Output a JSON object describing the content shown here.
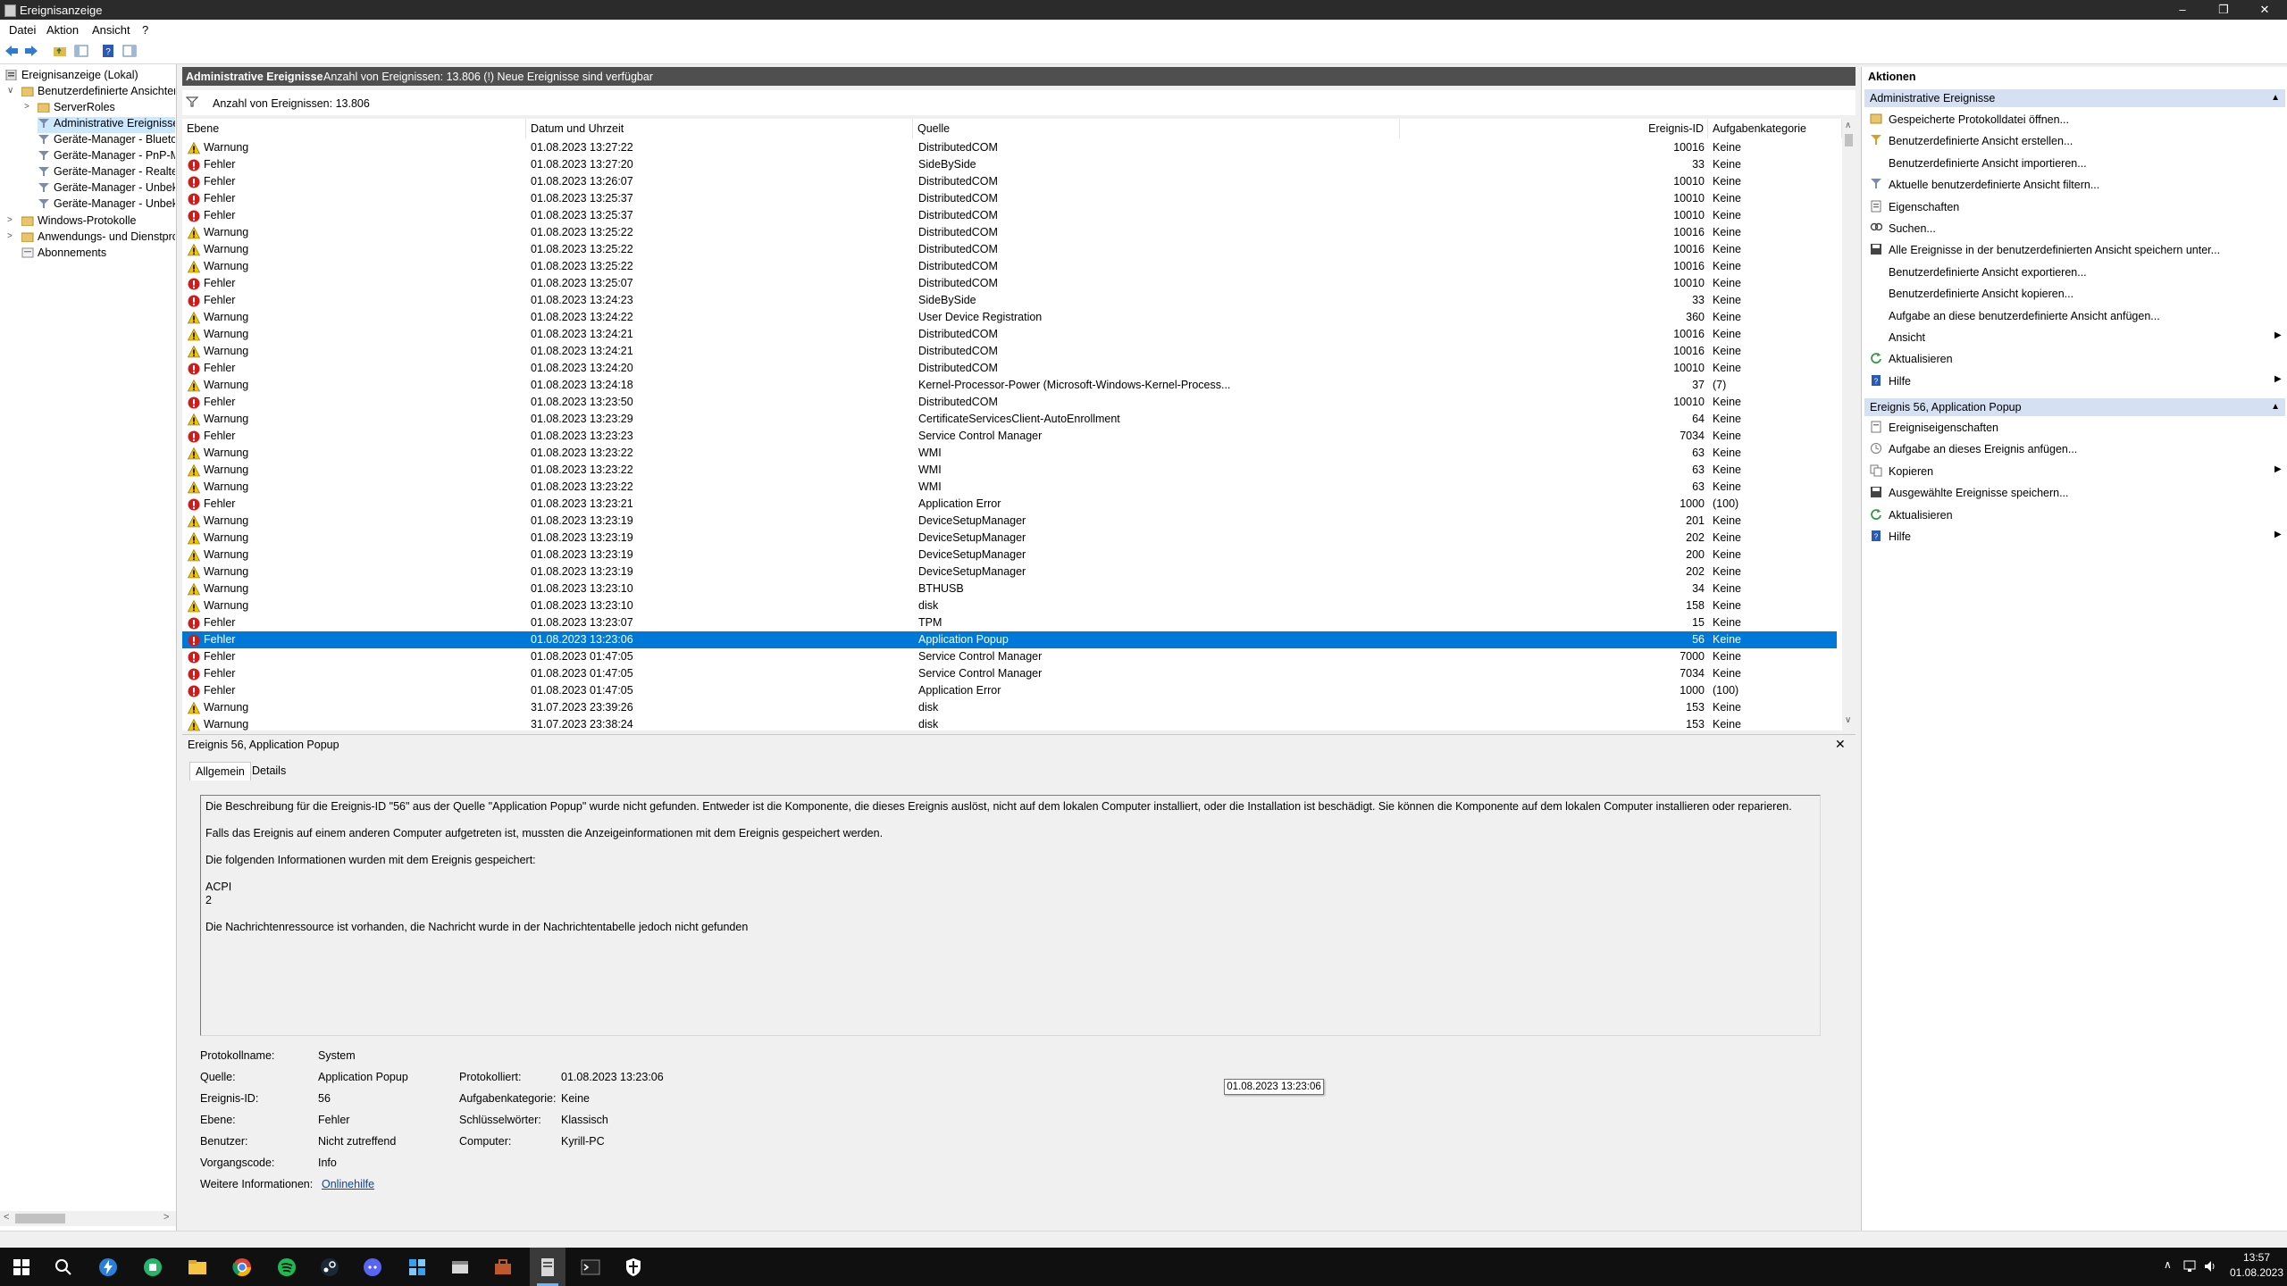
{
  "window": {
    "title": "Ereignisanzeige"
  },
  "menu": [
    "Datei",
    "Aktion",
    "Ansicht",
    "?"
  ],
  "tree": {
    "root": "Ereignisanzeige (Lokal)",
    "custom_views": "Benutzerdefinierte Ansichten",
    "children": [
      "ServerRoles",
      "Administrative Ereignisse",
      "Geräte-Manager - Blueto",
      "Geräte-Manager - PnP-M",
      "Geräte-Manager - Realtel",
      "Geräte-Manager - Unbek",
      "Geräte-Manager - Unbek"
    ],
    "windows_logs": "Windows-Protokolle",
    "app_logs": "Anwendungs- und Dienstpro",
    "subscriptions": "Abonnements"
  },
  "center": {
    "title": "Administrative Ereignisse",
    "subtitle": "Anzahl von Ereignissen: 13.806 (!) Neue Ereignisse sind verfügbar",
    "filter_text": "Anzahl von Ereignissen: 13.806",
    "columns": {
      "level": "Ebene",
      "date": "Datum und Uhrzeit",
      "source": "Quelle",
      "id": "Ereignis-ID",
      "task": "Aufgabenkategorie"
    }
  },
  "events": [
    {
      "level": "Warnung",
      "date": "01.08.2023 13:27:22",
      "source": "DistributedCOM",
      "id": "10016",
      "task": "Keine"
    },
    {
      "level": "Fehler",
      "date": "01.08.2023 13:27:20",
      "source": "SideBySide",
      "id": "33",
      "task": "Keine"
    },
    {
      "level": "Fehler",
      "date": "01.08.2023 13:26:07",
      "source": "DistributedCOM",
      "id": "10010",
      "task": "Keine"
    },
    {
      "level": "Fehler",
      "date": "01.08.2023 13:25:37",
      "source": "DistributedCOM",
      "id": "10010",
      "task": "Keine"
    },
    {
      "level": "Fehler",
      "date": "01.08.2023 13:25:37",
      "source": "DistributedCOM",
      "id": "10010",
      "task": "Keine"
    },
    {
      "level": "Warnung",
      "date": "01.08.2023 13:25:22",
      "source": "DistributedCOM",
      "id": "10016",
      "task": "Keine"
    },
    {
      "level": "Warnung",
      "date": "01.08.2023 13:25:22",
      "source": "DistributedCOM",
      "id": "10016",
      "task": "Keine"
    },
    {
      "level": "Warnung",
      "date": "01.08.2023 13:25:22",
      "source": "DistributedCOM",
      "id": "10016",
      "task": "Keine"
    },
    {
      "level": "Fehler",
      "date": "01.08.2023 13:25:07",
      "source": "DistributedCOM",
      "id": "10010",
      "task": "Keine"
    },
    {
      "level": "Fehler",
      "date": "01.08.2023 13:24:23",
      "source": "SideBySide",
      "id": "33",
      "task": "Keine"
    },
    {
      "level": "Warnung",
      "date": "01.08.2023 13:24:22",
      "source": "User Device Registration",
      "id": "360",
      "task": "Keine"
    },
    {
      "level": "Warnung",
      "date": "01.08.2023 13:24:21",
      "source": "DistributedCOM",
      "id": "10016",
      "task": "Keine"
    },
    {
      "level": "Warnung",
      "date": "01.08.2023 13:24:21",
      "source": "DistributedCOM",
      "id": "10016",
      "task": "Keine"
    },
    {
      "level": "Fehler",
      "date": "01.08.2023 13:24:20",
      "source": "DistributedCOM",
      "id": "10010",
      "task": "Keine"
    },
    {
      "level": "Warnung",
      "date": "01.08.2023 13:24:18",
      "source": "Kernel-Processor-Power (Microsoft-Windows-Kernel-Process...",
      "id": "37",
      "task": "(7)"
    },
    {
      "level": "Fehler",
      "date": "01.08.2023 13:23:50",
      "source": "DistributedCOM",
      "id": "10010",
      "task": "Keine"
    },
    {
      "level": "Warnung",
      "date": "01.08.2023 13:23:29",
      "source": "CertificateServicesClient-AutoEnrollment",
      "id": "64",
      "task": "Keine"
    },
    {
      "level": "Fehler",
      "date": "01.08.2023 13:23:23",
      "source": "Service Control Manager",
      "id": "7034",
      "task": "Keine"
    },
    {
      "level": "Warnung",
      "date": "01.08.2023 13:23:22",
      "source": "WMI",
      "id": "63",
      "task": "Keine"
    },
    {
      "level": "Warnung",
      "date": "01.08.2023 13:23:22",
      "source": "WMI",
      "id": "63",
      "task": "Keine"
    },
    {
      "level": "Warnung",
      "date": "01.08.2023 13:23:22",
      "source": "WMI",
      "id": "63",
      "task": "Keine"
    },
    {
      "level": "Fehler",
      "date": "01.08.2023 13:23:21",
      "source": "Application Error",
      "id": "1000",
      "task": "(100)"
    },
    {
      "level": "Warnung",
      "date": "01.08.2023 13:23:19",
      "source": "DeviceSetupManager",
      "id": "201",
      "task": "Keine"
    },
    {
      "level": "Warnung",
      "date": "01.08.2023 13:23:19",
      "source": "DeviceSetupManager",
      "id": "202",
      "task": "Keine"
    },
    {
      "level": "Warnung",
      "date": "01.08.2023 13:23:19",
      "source": "DeviceSetupManager",
      "id": "200",
      "task": "Keine"
    },
    {
      "level": "Warnung",
      "date": "01.08.2023 13:23:19",
      "source": "DeviceSetupManager",
      "id": "202",
      "task": "Keine"
    },
    {
      "level": "Warnung",
      "date": "01.08.2023 13:23:10",
      "source": "BTHUSB",
      "id": "34",
      "task": "Keine"
    },
    {
      "level": "Warnung",
      "date": "01.08.2023 13:23:10",
      "source": "disk",
      "id": "158",
      "task": "Keine"
    },
    {
      "level": "Fehler",
      "date": "01.08.2023 13:23:07",
      "source": "TPM",
      "id": "15",
      "task": "Keine"
    },
    {
      "level": "Fehler",
      "date": "01.08.2023 13:23:06",
      "source": "Application Popup",
      "id": "56",
      "task": "Keine",
      "selected": true
    },
    {
      "level": "Fehler",
      "date": "01.08.2023 01:47:05",
      "source": "Service Control Manager",
      "id": "7000",
      "task": "Keine"
    },
    {
      "level": "Fehler",
      "date": "01.08.2023 01:47:05",
      "source": "Service Control Manager",
      "id": "7034",
      "task": "Keine"
    },
    {
      "level": "Fehler",
      "date": "01.08.2023 01:47:05",
      "source": "Application Error",
      "id": "1000",
      "task": "(100)"
    },
    {
      "level": "Warnung",
      "date": "31.07.2023 23:39:26",
      "source": "disk",
      "id": "153",
      "task": "Keine"
    },
    {
      "level": "Warnung",
      "date": "31.07.2023 23:38:24",
      "source": "disk",
      "id": "153",
      "task": "Keine"
    }
  ],
  "detail": {
    "title": "Ereignis 56, Application Popup",
    "tabs": [
      "Allgemein",
      "Details"
    ],
    "message": [
      "Die Beschreibung für die Ereignis-ID \"56\" aus der Quelle \"Application Popup\" wurde nicht gefunden. Entweder ist die Komponente, die dieses Ereignis auslöst, nicht auf dem lokalen Computer installiert, oder die Installation ist beschädigt. Sie können die Komponente auf dem lokalen Computer installieren oder reparieren.",
      "Falls das Ereignis auf einem anderen Computer aufgetreten ist, mussten die Anzeigeinformationen mit dem Ereignis gespeichert werden.",
      "Die folgenden Informationen wurden mit dem Ereignis gespeichert:",
      "ACPI",
      "2",
      "Die Nachrichtenressource ist vorhanden, die Nachricht wurde in der Nachrichtentabelle jedoch nicht gefunden"
    ],
    "fields": {
      "log_name_label": "Protokollname:",
      "log_name": "System",
      "source_label": "Quelle:",
      "source": "Application Popup",
      "logged_label": "Protokolliert:",
      "logged": "01.08.2023 13:23:06",
      "event_id_label": "Ereignis-ID:",
      "event_id": "56",
      "task_label": "Aufgabenkategorie:",
      "task": "Keine",
      "level_label": "Ebene:",
      "level": "Fehler",
      "keywords_label": "Schlüsselwörter:",
      "keywords": "Klassisch",
      "user_label": "Benutzer:",
      "user": "Nicht zutreffend",
      "computer_label": "Computer:",
      "computer": "Kyrill-PC",
      "opcode_label": "Vorgangscode:",
      "opcode": "Info",
      "more_label": "Weitere Informationen:",
      "more_link": "Onlinehilfe"
    },
    "tooltip": "01.08.2023 13:23:06"
  },
  "actions": {
    "header": "Aktionen",
    "section1": {
      "title": "Administrative Ereignisse",
      "items": [
        {
          "label": "Gespeicherte Protokolldatei öffnen...",
          "icon": "open-log-icon"
        },
        {
          "label": "Benutzerdefinierte Ansicht erstellen...",
          "icon": "filter-create-icon"
        },
        {
          "label": "Benutzerdefinierte Ansicht importieren...",
          "icon": ""
        },
        {
          "label": "Aktuelle benutzerdefinierte Ansicht filtern...",
          "icon": "filter-icon"
        },
        {
          "label": "Eigenschaften",
          "icon": "properties-icon"
        },
        {
          "label": "Suchen...",
          "icon": "find-icon"
        },
        {
          "label": "Alle Ereignisse in der benutzerdefinierten Ansicht speichern unter...",
          "icon": "save-icon"
        },
        {
          "label": "Benutzerdefinierte Ansicht exportieren...",
          "icon": ""
        },
        {
          "label": "Benutzerdefinierte Ansicht kopieren...",
          "icon": ""
        },
        {
          "label": "Aufgabe an diese benutzerdefinierte Ansicht anfügen...",
          "icon": ""
        },
        {
          "label": "Ansicht",
          "icon": "",
          "submenu": true
        },
        {
          "label": "Aktualisieren",
          "icon": "refresh-icon"
        },
        {
          "label": "Hilfe",
          "icon": "help-icon",
          "submenu": true
        }
      ]
    },
    "section2": {
      "title": "Ereignis 56, Application Popup",
      "items": [
        {
          "label": "Ereigniseigenschaften",
          "icon": "event-properties-icon"
        },
        {
          "label": "Aufgabe an dieses Ereignis anfügen...",
          "icon": "task-icon"
        },
        {
          "label": "Kopieren",
          "icon": "copy-icon",
          "submenu": true
        },
        {
          "label": "Ausgewählte Ereignisse speichern...",
          "icon": "save-icon"
        },
        {
          "label": "Aktualisieren",
          "icon": "refresh-icon"
        },
        {
          "label": "Hilfe",
          "icon": "help-icon",
          "submenu": true
        }
      ]
    }
  },
  "taskbar": {
    "time": "13:57",
    "date": "01.08.2023"
  },
  "colors": {
    "selection": "#0078d7",
    "section_header": "#d5e1f2",
    "error": "#d11b1b",
    "warning": "#f5c400"
  }
}
